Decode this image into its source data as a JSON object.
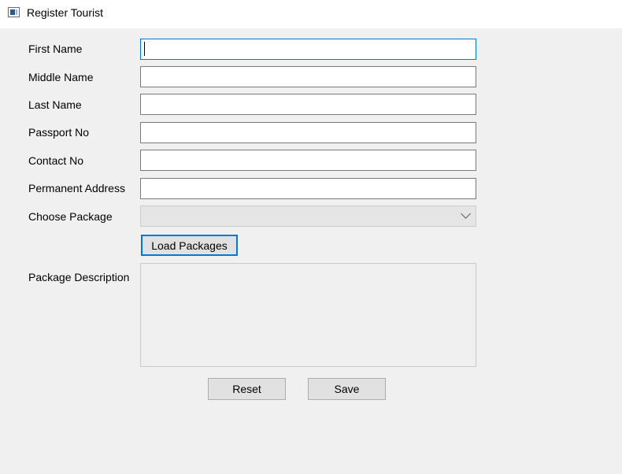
{
  "window": {
    "title": "Register Tourist",
    "icon": "window-app-icon"
  },
  "form": {
    "first_name": {
      "label": "First Name",
      "value": ""
    },
    "middle_name": {
      "label": "Middle Name",
      "value": ""
    },
    "last_name": {
      "label": "Last Name",
      "value": ""
    },
    "passport_no": {
      "label": "Passport No",
      "value": ""
    },
    "contact_no": {
      "label": "Contact No",
      "value": ""
    },
    "permanent_address": {
      "label": "Permanent Address",
      "value": ""
    },
    "choose_package": {
      "label": "Choose Package",
      "selected": "",
      "icon": "chevron-down-icon"
    },
    "load_packages_label": "Load Packages",
    "package_description": {
      "label": "Package Description",
      "value": ""
    }
  },
  "actions": {
    "reset_label": "Reset",
    "save_label": "Save"
  },
  "colors": {
    "focus_accent": "#0078d7",
    "window_bg": "#f0f0f0",
    "titlebar_bg": "#ffffff"
  }
}
